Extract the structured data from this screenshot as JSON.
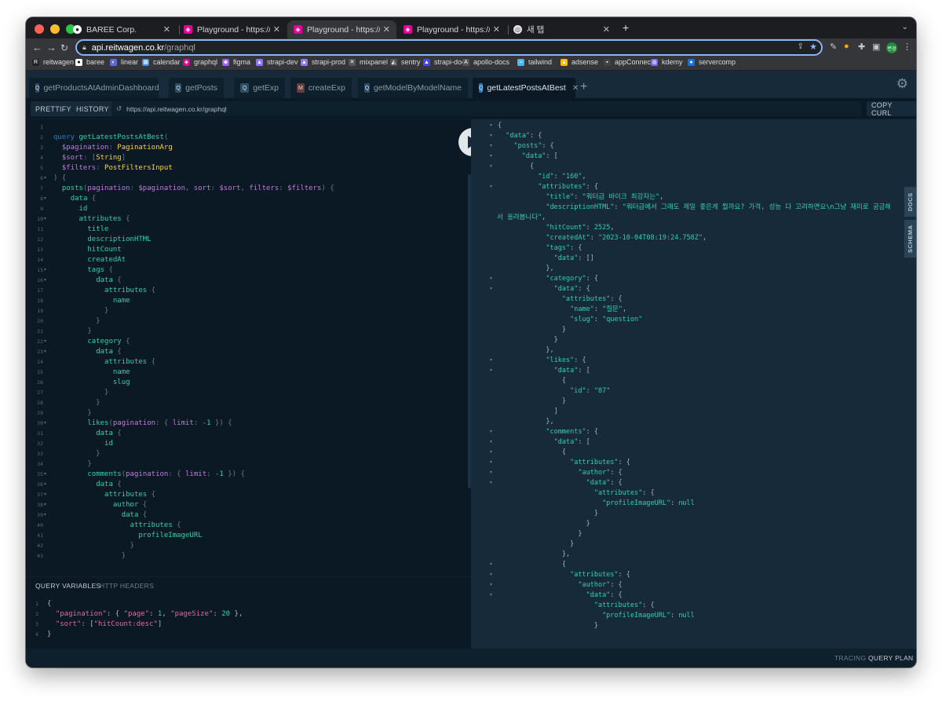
{
  "browser": {
    "tabs": [
      {
        "title": "BAREE Corp.",
        "favicon": "github-icon",
        "active": false
      },
      {
        "title": "Playground - https://api.dev.re",
        "favicon": "graphql-icon",
        "active": false
      },
      {
        "title": "Playground - https://api.reitwa",
        "favicon": "graphql-icon",
        "active": true
      },
      {
        "title": "Playground - https://api.reitwa",
        "favicon": "graphql-icon",
        "active": false
      },
      {
        "title": "새 탭",
        "favicon": "chrome-icon",
        "active": false
      }
    ],
    "new_tab_label": "+",
    "url_host": "api.reitwagen.co.kr",
    "url_path": "/graphql",
    "profile_label": "변경",
    "bookmarks": [
      "reitwagen",
      "baree",
      "linear",
      "calendar",
      "graphql",
      "figma",
      "strapi-dev",
      "strapi-prod",
      "mixpanel",
      "sentry",
      "strapi-docs",
      "apollo-docs",
      "tailwind",
      "adsense",
      "appConnect",
      "kdemy",
      "servercomp"
    ]
  },
  "playground": {
    "query_tabs": [
      {
        "badge": "Q",
        "label": "getProductsAtAdminDashboard",
        "active": false
      },
      {
        "badge": "Q",
        "label": "getPosts",
        "active": false
      },
      {
        "badge": "Q",
        "label": "getExp",
        "active": false
      },
      {
        "badge": "M",
        "label": "createExp",
        "active": false
      },
      {
        "badge": "Q",
        "label": "getModelByModelName",
        "active": false
      },
      {
        "badge": "Q",
        "label": "getLatestPostsAtBest",
        "active": true
      }
    ],
    "add_tab": "+",
    "toolbar": {
      "prettify": "PRETTIFY",
      "history": "HISTORY",
      "endpoint": "https://api.reitwagen.co.kr/graphql",
      "copy_curl": "COPY CURL"
    },
    "variables_tabs": {
      "query_variables": "QUERY VARIABLES",
      "http_headers": "HTTP HEADERS"
    },
    "side_tabs": {
      "docs": "DOCS",
      "schema": "SCHEMA"
    },
    "footer": {
      "tracing": "TRACING",
      "query_plan": "QUERY PLAN"
    }
  },
  "editor_lines": [
    [],
    [
      [
        "kw",
        "query "
      ],
      [
        "fn",
        "getLatestPostsAtBest"
      ],
      [
        "pu",
        "("
      ]
    ],
    [
      [
        "pu",
        "  "
      ],
      [
        "var",
        "$pagination"
      ],
      [
        "pu",
        ": "
      ],
      [
        "ty",
        "PaginationArg"
      ]
    ],
    [
      [
        "pu",
        "  "
      ],
      [
        "var",
        "$sort"
      ],
      [
        "pu",
        ": ["
      ],
      [
        "ty",
        "String"
      ],
      [
        "pu",
        "]"
      ]
    ],
    [
      [
        "pu",
        "  "
      ],
      [
        "var",
        "$filters"
      ],
      [
        "pu",
        ": "
      ],
      [
        "ty",
        "PostFiltersInput"
      ]
    ],
    [
      [
        "pu",
        ") {"
      ]
    ],
    [
      [
        "pu",
        "  "
      ],
      [
        "fl",
        "posts"
      ],
      [
        "pu",
        "("
      ],
      [
        "arg",
        "pagination"
      ],
      [
        "pu",
        ": "
      ],
      [
        "var",
        "$pagination"
      ],
      [
        "pu",
        ", "
      ],
      [
        "arg",
        "sort"
      ],
      [
        "pu",
        ": "
      ],
      [
        "var",
        "$sort"
      ],
      [
        "pu",
        ", "
      ],
      [
        "arg",
        "filters"
      ],
      [
        "pu",
        ": "
      ],
      [
        "var",
        "$filters"
      ],
      [
        "pu",
        ") {"
      ]
    ],
    [
      [
        "pu",
        "    "
      ],
      [
        "fl",
        "data"
      ],
      [
        "pu",
        " {"
      ]
    ],
    [
      [
        "pu",
        "      "
      ],
      [
        "fl",
        "id"
      ]
    ],
    [
      [
        "pu",
        "      "
      ],
      [
        "fl",
        "attributes"
      ],
      [
        "pu",
        " {"
      ]
    ],
    [
      [
        "pu",
        "        "
      ],
      [
        "fl",
        "title"
      ]
    ],
    [
      [
        "pu",
        "        "
      ],
      [
        "fl",
        "descriptionHTML"
      ]
    ],
    [
      [
        "pu",
        "        "
      ],
      [
        "fl",
        "hitCount"
      ]
    ],
    [
      [
        "pu",
        "        "
      ],
      [
        "fl",
        "createdAt"
      ]
    ],
    [
      [
        "pu",
        "        "
      ],
      [
        "fl",
        "tags"
      ],
      [
        "pu",
        " {"
      ]
    ],
    [
      [
        "pu",
        "          "
      ],
      [
        "fl",
        "data"
      ],
      [
        "pu",
        " {"
      ]
    ],
    [
      [
        "pu",
        "            "
      ],
      [
        "fl",
        "attributes"
      ],
      [
        "pu",
        " {"
      ]
    ],
    [
      [
        "pu",
        "              "
      ],
      [
        "fl",
        "name"
      ]
    ],
    [
      [
        "pu",
        "            }"
      ]
    ],
    [
      [
        "pu",
        "          }"
      ]
    ],
    [
      [
        "pu",
        "        }"
      ]
    ],
    [
      [
        "pu",
        "        "
      ],
      [
        "fl",
        "category"
      ],
      [
        "pu",
        " {"
      ]
    ],
    [
      [
        "pu",
        "          "
      ],
      [
        "fl",
        "data"
      ],
      [
        "pu",
        " {"
      ]
    ],
    [
      [
        "pu",
        "            "
      ],
      [
        "fl",
        "attributes"
      ],
      [
        "pu",
        " {"
      ]
    ],
    [
      [
        "pu",
        "              "
      ],
      [
        "fl",
        "name"
      ]
    ],
    [
      [
        "pu",
        "              "
      ],
      [
        "fl",
        "slug"
      ]
    ],
    [
      [
        "pu",
        "            }"
      ]
    ],
    [
      [
        "pu",
        "          }"
      ]
    ],
    [
      [
        "pu",
        "        }"
      ]
    ],
    [
      [
        "pu",
        "        "
      ],
      [
        "fl",
        "likes"
      ],
      [
        "pu",
        "("
      ],
      [
        "arg",
        "pagination"
      ],
      [
        "pu",
        ": { "
      ],
      [
        "arg",
        "limit"
      ],
      [
        "pu",
        ": "
      ],
      [
        "num",
        "-1"
      ],
      [
        "pu",
        " }) {"
      ]
    ],
    [
      [
        "pu",
        "          "
      ],
      [
        "fl",
        "data"
      ],
      [
        "pu",
        " {"
      ]
    ],
    [
      [
        "pu",
        "            "
      ],
      [
        "fl",
        "id"
      ]
    ],
    [
      [
        "pu",
        "          }"
      ]
    ],
    [
      [
        "pu",
        "        }"
      ]
    ],
    [
      [
        "pu",
        "        "
      ],
      [
        "fl",
        "comments"
      ],
      [
        "pu",
        "("
      ],
      [
        "arg",
        "pagination"
      ],
      [
        "pu",
        ": { "
      ],
      [
        "arg",
        "limit"
      ],
      [
        "pu",
        ": "
      ],
      [
        "num",
        "-1"
      ],
      [
        "pu",
        " }) {"
      ]
    ],
    [
      [
        "pu",
        "          "
      ],
      [
        "fl",
        "data"
      ],
      [
        "pu",
        " {"
      ]
    ],
    [
      [
        "pu",
        "            "
      ],
      [
        "fl",
        "attributes"
      ],
      [
        "pu",
        " {"
      ]
    ],
    [
      [
        "pu",
        "              "
      ],
      [
        "fl",
        "author"
      ],
      [
        "pu",
        " {"
      ]
    ],
    [
      [
        "pu",
        "                "
      ],
      [
        "fl",
        "data"
      ],
      [
        "pu",
        " {"
      ]
    ],
    [
      [
        "pu",
        "                  "
      ],
      [
        "fl",
        "attributes"
      ],
      [
        "pu",
        " {"
      ]
    ],
    [
      [
        "pu",
        "                    "
      ],
      [
        "fl",
        "profileImageURL"
      ]
    ],
    [
      [
        "pu",
        "                  }"
      ]
    ],
    [
      [
        "pu",
        "                }"
      ]
    ]
  ],
  "editor_folds": [
    6,
    8,
    10,
    15,
    16,
    22,
    23,
    30,
    35,
    36,
    37,
    38,
    39
  ],
  "variables_lines": [
    [
      [
        "vp",
        "{"
      ]
    ],
    [
      [
        "vp",
        "  "
      ],
      [
        "vk",
        "\"pagination\""
      ],
      [
        "vp",
        ": { "
      ],
      [
        "vk",
        "\"page\""
      ],
      [
        "vp",
        ": "
      ],
      [
        "vn",
        "1"
      ],
      [
        "vp",
        ", "
      ],
      [
        "vk",
        "\"pageSize\""
      ],
      [
        "vp",
        ": "
      ],
      [
        "vn",
        "20"
      ],
      [
        "vp",
        " },"
      ]
    ],
    [
      [
        "vp",
        "  "
      ],
      [
        "vk",
        "\"sort\""
      ],
      [
        "vp",
        ": ["
      ],
      [
        "vs",
        "\"hitCount:desc\""
      ],
      [
        "vp",
        "]"
      ]
    ],
    [
      [
        "vp",
        "}"
      ]
    ]
  ],
  "result_lines": [
    {
      "t": [
        [
          "rp",
          "{"
        ]
      ],
      "f": 1
    },
    {
      "t": [
        [
          "rp",
          "  "
        ],
        [
          "rk",
          "\"data\""
        ],
        [
          "rp",
          ": {"
        ]
      ],
      "f": 1
    },
    {
      "t": [
        [
          "rp",
          "    "
        ],
        [
          "rk",
          "\"posts\""
        ],
        [
          "rp",
          ": {"
        ]
      ],
      "f": 1
    },
    {
      "t": [
        [
          "rp",
          "      "
        ],
        [
          "rk",
          "\"data\""
        ],
        [
          "rp",
          ": ["
        ]
      ],
      "f": 1
    },
    {
      "t": [
        [
          "rp",
          "        {"
        ]
      ],
      "f": 1
    },
    {
      "t": [
        [
          "rp",
          "          "
        ],
        [
          "rk",
          "\"id\""
        ],
        [
          "rp",
          ": "
        ],
        [
          "rs",
          "\"160\""
        ],
        [
          "rp",
          ","
        ]
      ],
      "f": 0
    },
    {
      "t": [
        [
          "rp",
          "          "
        ],
        [
          "rk",
          "\"attributes\""
        ],
        [
          "rp",
          ": {"
        ]
      ],
      "f": 1
    },
    {
      "t": [
        [
          "rp",
          "            "
        ],
        [
          "rk",
          "\"title\""
        ],
        [
          "rp",
          ": "
        ],
        [
          "rs",
          "\"쿼터급 바이크 최강자는\""
        ],
        [
          "rp",
          ","
        ]
      ],
      "f": 0
    },
    {
      "t": [
        [
          "rp",
          "            "
        ],
        [
          "rk",
          "\"descriptionHTML\""
        ],
        [
          "rp",
          ": "
        ],
        [
          "rs",
          "\"쿼터급에서 그래도 제일 좋은게 뭘까요? 가격, 성능 다 고려하면요\\n그냥 재미로 궁금해"
        ]
      ],
      "f": 0
    },
    {
      "t": [
        [
          "rs",
          "서 올려봅니다\""
        ],
        [
          "rp",
          ","
        ]
      ],
      "f": 0,
      "indent0": 1
    },
    {
      "t": [
        [
          "rp",
          "            "
        ],
        [
          "rk",
          "\"hitCount\""
        ],
        [
          "rp",
          ": "
        ],
        [
          "rs",
          "2525"
        ],
        [
          "rp",
          ","
        ]
      ],
      "f": 0
    },
    {
      "t": [
        [
          "rp",
          "            "
        ],
        [
          "rk",
          "\"createdAt\""
        ],
        [
          "rp",
          ": "
        ],
        [
          "rs",
          "\"2023-10-04T08:19:24.758Z\""
        ],
        [
          "rp",
          ","
        ]
      ],
      "f": 0
    },
    {
      "t": [
        [
          "rp",
          "            "
        ],
        [
          "rk",
          "\"tags\""
        ],
        [
          "rp",
          ": {"
        ]
      ],
      "f": 0
    },
    {
      "t": [
        [
          "rp",
          "              "
        ],
        [
          "rk",
          "\"data\""
        ],
        [
          "rp",
          ": []"
        ]
      ],
      "f": 0
    },
    {
      "t": [
        [
          "rp",
          "            },"
        ]
      ],
      "f": 0
    },
    {
      "t": [
        [
          "rp",
          "            "
        ],
        [
          "rk",
          "\"category\""
        ],
        [
          "rp",
          ": {"
        ]
      ],
      "f": 1
    },
    {
      "t": [
        [
          "rp",
          "              "
        ],
        [
          "rk",
          "\"data\""
        ],
        [
          "rp",
          ": {"
        ]
      ],
      "f": 1
    },
    {
      "t": [
        [
          "rp",
          "                "
        ],
        [
          "rk",
          "\"attributes\""
        ],
        [
          "rp",
          ": {"
        ]
      ],
      "f": 0
    },
    {
      "t": [
        [
          "rp",
          "                  "
        ],
        [
          "rk",
          "\"name\""
        ],
        [
          "rp",
          ": "
        ],
        [
          "rs",
          "\"질문\""
        ],
        [
          "rp",
          ","
        ]
      ],
      "f": 0
    },
    {
      "t": [
        [
          "rp",
          "                  "
        ],
        [
          "rk",
          "\"slug\""
        ],
        [
          "rp",
          ": "
        ],
        [
          "rs",
          "\"question\""
        ]
      ],
      "f": 0
    },
    {
      "t": [
        [
          "rp",
          "                }"
        ]
      ],
      "f": 0
    },
    {
      "t": [
        [
          "rp",
          "              }"
        ]
      ],
      "f": 0
    },
    {
      "t": [
        [
          "rp",
          "            },"
        ]
      ],
      "f": 0
    },
    {
      "t": [
        [
          "rp",
          "            "
        ],
        [
          "rk",
          "\"likes\""
        ],
        [
          "rp",
          ": {"
        ]
      ],
      "f": 1
    },
    {
      "t": [
        [
          "rp",
          "              "
        ],
        [
          "rk",
          "\"data\""
        ],
        [
          "rp",
          ": ["
        ]
      ],
      "f": 1
    },
    {
      "t": [
        [
          "rp",
          "                {"
        ]
      ],
      "f": 0
    },
    {
      "t": [
        [
          "rp",
          "                  "
        ],
        [
          "rk",
          "\"id\""
        ],
        [
          "rp",
          ": "
        ],
        [
          "rs",
          "\"87\""
        ]
      ],
      "f": 0
    },
    {
      "t": [
        [
          "rp",
          "                }"
        ]
      ],
      "f": 0
    },
    {
      "t": [
        [
          "rp",
          "              ]"
        ]
      ],
      "f": 0
    },
    {
      "t": [
        [
          "rp",
          "            },"
        ]
      ],
      "f": 0
    },
    {
      "t": [
        [
          "rp",
          "            "
        ],
        [
          "rk",
          "\"comments\""
        ],
        [
          "rp",
          ": {"
        ]
      ],
      "f": 1
    },
    {
      "t": [
        [
          "rp",
          "              "
        ],
        [
          "rk",
          "\"data\""
        ],
        [
          "rp",
          ": ["
        ]
      ],
      "f": 1
    },
    {
      "t": [
        [
          "rp",
          "                {"
        ]
      ],
      "f": 1
    },
    {
      "t": [
        [
          "rp",
          "                  "
        ],
        [
          "rk",
          "\"attributes\""
        ],
        [
          "rp",
          ": {"
        ]
      ],
      "f": 1
    },
    {
      "t": [
        [
          "rp",
          "                    "
        ],
        [
          "rk",
          "\"author\""
        ],
        [
          "rp",
          ": {"
        ]
      ],
      "f": 1
    },
    {
      "t": [
        [
          "rp",
          "                      "
        ],
        [
          "rk",
          "\"data\""
        ],
        [
          "rp",
          ": {"
        ]
      ],
      "f": 1
    },
    {
      "t": [
        [
          "rp",
          "                        "
        ],
        [
          "rk",
          "\"attributes\""
        ],
        [
          "rp",
          ": {"
        ]
      ],
      "f": 0
    },
    {
      "t": [
        [
          "rp",
          "                          "
        ],
        [
          "rk",
          "\"profileImageURL\""
        ],
        [
          "rp",
          ": "
        ],
        [
          "rk",
          "null"
        ]
      ],
      "f": 0
    },
    {
      "t": [
        [
          "rp",
          "                        }"
        ]
      ],
      "f": 0
    },
    {
      "t": [
        [
          "rp",
          "                      }"
        ]
      ],
      "f": 0
    },
    {
      "t": [
        [
          "rp",
          "                    }"
        ]
      ],
      "f": 0
    },
    {
      "t": [
        [
          "rp",
          "                  }"
        ]
      ],
      "f": 0
    },
    {
      "t": [
        [
          "rp",
          "                },"
        ]
      ],
      "f": 0
    },
    {
      "t": [
        [
          "rp",
          "                {"
        ]
      ],
      "f": 1
    },
    {
      "t": [
        [
          "rp",
          "                  "
        ],
        [
          "rk",
          "\"attributes\""
        ],
        [
          "rp",
          ": {"
        ]
      ],
      "f": 1
    },
    {
      "t": [
        [
          "rp",
          "                    "
        ],
        [
          "rk",
          "\"author\""
        ],
        [
          "rp",
          ": {"
        ]
      ],
      "f": 1
    },
    {
      "t": [
        [
          "rp",
          "                      "
        ],
        [
          "rk",
          "\"data\""
        ],
        [
          "rp",
          ": {"
        ]
      ],
      "f": 1
    },
    {
      "t": [
        [
          "rp",
          "                        "
        ],
        [
          "rk",
          "\"attributes\""
        ],
        [
          "rp",
          ": {"
        ]
      ],
      "f": 0
    },
    {
      "t": [
        [
          "rp",
          "                          "
        ],
        [
          "rk",
          "\"profileImageURL\""
        ],
        [
          "rp",
          ": "
        ],
        [
          "rk",
          "null"
        ]
      ],
      "f": 0
    },
    {
      "t": [
        [
          "rp",
          "                        }"
        ]
      ],
      "f": 0
    }
  ]
}
